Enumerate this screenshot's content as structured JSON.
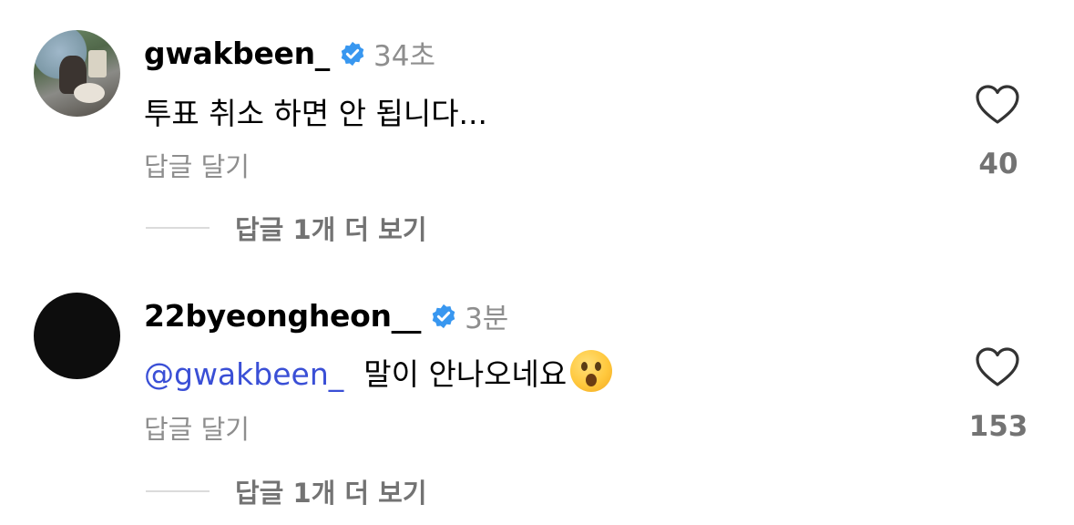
{
  "comments": [
    {
      "username": "gwakbeen_",
      "time": "34초",
      "mention": "",
      "text": "투표 취소 하면 안 됩니다...",
      "reply_label": "답글 달기",
      "likes": "40",
      "more_replies": "답글 1개 더 보기",
      "avatar_icon": "profile-photo",
      "verified_icon": "verified-badge-icon"
    },
    {
      "username": "22byeongheon__",
      "time": "3분",
      "mention": "@gwakbeen_",
      "text": "말이 안나오네요",
      "reply_label": "답글 달기",
      "likes": "153",
      "more_replies": "답글 1개 더 보기",
      "avatar_icon": "profile-photo-dark",
      "verified_icon": "verified-badge-icon",
      "emoji": "hushed-face-emoji"
    }
  ],
  "colors": {
    "mention": "#3a4fd6",
    "verified": "#3897f0",
    "secondary_text": "#8e8e8e",
    "divider": "#dbdbdb"
  }
}
